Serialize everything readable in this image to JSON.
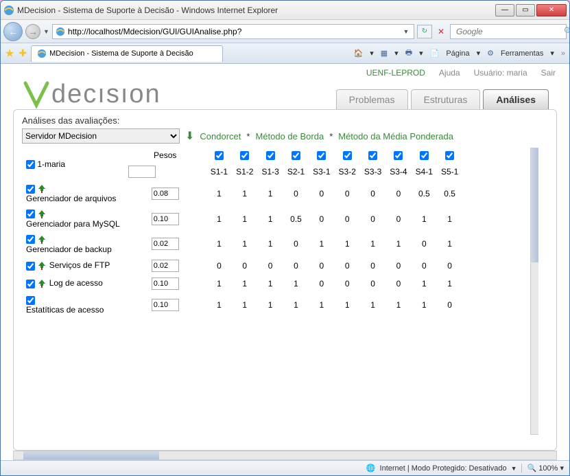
{
  "window": {
    "title": "MDecision - Sistema de Suporte à  Decisão - Windows Internet Explorer"
  },
  "address": "http://localhost/Mdecision/GUI/GUIAnalise.php?",
  "search_placeholder": "Google",
  "tab_title": "MDecision - Sistema de Suporte à  Decisão",
  "toolbar": {
    "pagina": "Página",
    "ferramentas": "Ferramentas"
  },
  "topnav": {
    "uenf": "UENF-LEPROD",
    "ajuda": "Ajuda",
    "usuario_label": "Usuário:",
    "usuario": "maria",
    "sair": "Sair"
  },
  "logo_text": "decısıon",
  "maintabs": {
    "problemas": "Problemas",
    "estruturas": "Estruturas",
    "analises": "Análises"
  },
  "panel": {
    "title": "Análises das avaliações:",
    "select": "Servidor MDecision"
  },
  "methods": {
    "condorcet": "Condorcet",
    "borda": "Método de Borda",
    "media": "Método da Média Ponderada"
  },
  "header": {
    "first": "1-maria",
    "pesos": "Pesos",
    "cols": [
      "S1-1",
      "S1-2",
      "S1-3",
      "S2-1",
      "S3-1",
      "S3-2",
      "S3-3",
      "S3-4",
      "S4-1",
      "S5-1"
    ]
  },
  "rows": [
    {
      "label": "Gerenciador de arquivos",
      "peso": "0.08",
      "vals": [
        "1",
        "1",
        "1",
        "0",
        "0",
        "0",
        "0",
        "0",
        "0.5",
        "0.5"
      ],
      "tree": true
    },
    {
      "label": "Gerenciador para MySQL",
      "peso": "0.10",
      "vals": [
        "1",
        "1",
        "1",
        "0.5",
        "0",
        "0",
        "0",
        "0",
        "1",
        "1"
      ],
      "tree": true
    },
    {
      "label": "Gerenciador de backup",
      "peso": "0.02",
      "vals": [
        "1",
        "1",
        "1",
        "0",
        "1",
        "1",
        "1",
        "1",
        "0",
        "1"
      ],
      "tree": true
    },
    {
      "label": "Serviços de FTP",
      "peso": "0.02",
      "vals": [
        "0",
        "0",
        "0",
        "0",
        "0",
        "0",
        "0",
        "0",
        "0",
        "0"
      ],
      "tree": true,
      "inline": true
    },
    {
      "label": "Log de acesso",
      "peso": "0.10",
      "vals": [
        "1",
        "1",
        "1",
        "1",
        "0",
        "0",
        "0",
        "0",
        "1",
        "1"
      ],
      "tree": true,
      "inline": true
    },
    {
      "label": "Estatíticas de acesso",
      "peso": "0.10",
      "vals": [
        "1",
        "1",
        "1",
        "1",
        "1",
        "1",
        "1",
        "1",
        "1",
        "0"
      ],
      "tree": false
    }
  ],
  "status": {
    "zone": "Internet | Modo Protegido: Desativado",
    "zoom": "100%"
  }
}
